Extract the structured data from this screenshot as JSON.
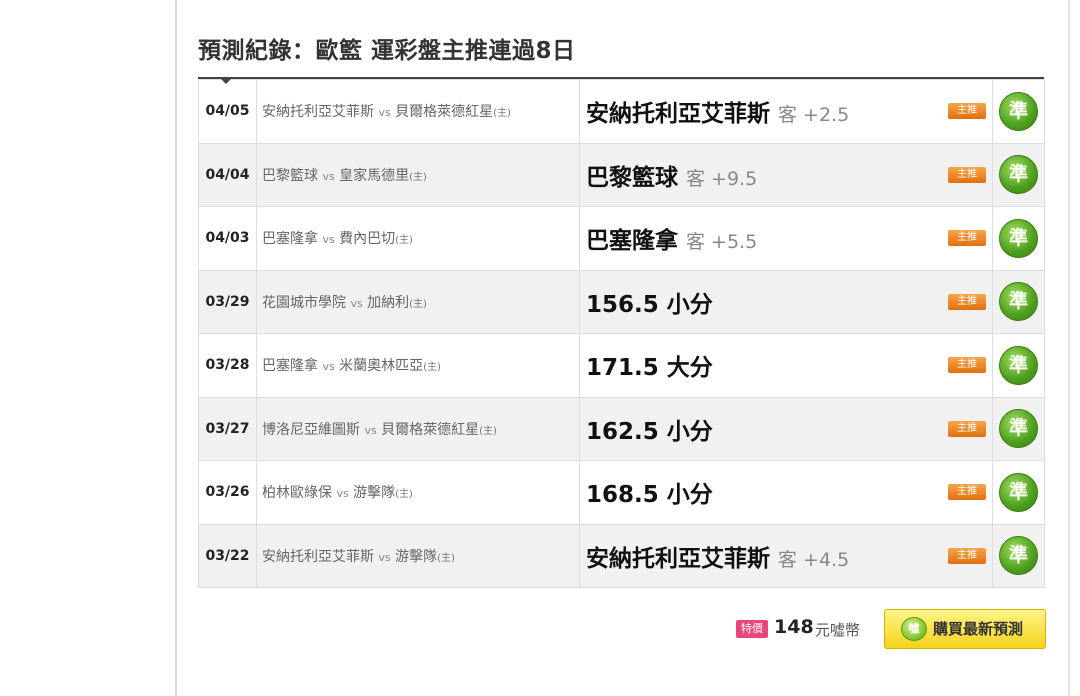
{
  "header": {
    "title_prefix": "預測紀錄：",
    "title_suffix": "歐籃 運彩盤主推連過8日"
  },
  "records": [
    {
      "date": "04/05",
      "team_a": "安納托利亞艾菲斯",
      "vs": "vs",
      "team_b": "貝爾格萊德紅星",
      "home_mark": "(主)",
      "pick": "安納托利亞艾菲斯",
      "pick_extra": "客 +2.5",
      "tag": "主推",
      "result": "準"
    },
    {
      "date": "04/04",
      "team_a": "巴黎籃球",
      "vs": "vs",
      "team_b": "皇家馬德里",
      "home_mark": "(主)",
      "pick": "巴黎籃球",
      "pick_extra": "客 +9.5",
      "tag": "主推",
      "result": "準"
    },
    {
      "date": "04/03",
      "team_a": "巴塞隆拿",
      "vs": "vs",
      "team_b": "費內巴切",
      "home_mark": "(主)",
      "pick": "巴塞隆拿",
      "pick_extra": "客 +5.5",
      "tag": "主推",
      "result": "準"
    },
    {
      "date": "03/29",
      "team_a": "花園城市學院",
      "vs": "vs",
      "team_b": "加納利",
      "home_mark": "(主)",
      "pick": "156.5 小分",
      "pick_extra": "",
      "tag": "主推",
      "result": "準"
    },
    {
      "date": "03/28",
      "team_a": "巴塞隆拿",
      "vs": "vs",
      "team_b": "米蘭奧林匹亞",
      "home_mark": "(主)",
      "pick": "171.5 大分",
      "pick_extra": "",
      "tag": "主推",
      "result": "準"
    },
    {
      "date": "03/27",
      "team_a": "博洛尼亞維圖斯",
      "vs": "vs",
      "team_b": "貝爾格萊德紅星",
      "home_mark": "(主)",
      "pick": "162.5 小分",
      "pick_extra": "",
      "tag": "主推",
      "result": "準"
    },
    {
      "date": "03/26",
      "team_a": "柏林歐綠保",
      "vs": "vs",
      "team_b": "游擊隊",
      "home_mark": "(主)",
      "pick": "168.5 小分",
      "pick_extra": "",
      "tag": "主推",
      "result": "準"
    },
    {
      "date": "03/22",
      "team_a": "安納托利亞艾菲斯",
      "vs": "vs",
      "team_b": "游擊隊",
      "home_mark": "(主)",
      "pick": "安納托利亞艾菲斯",
      "pick_extra": "客 +4.5",
      "tag": "主推",
      "result": "準"
    }
  ],
  "purchase": {
    "special_label": "特價",
    "price": "148",
    "unit": "元噓幣",
    "coin_label": "噓",
    "buy_label": "購買最新預測"
  },
  "colors": {
    "result_badge": "#4d9e1e",
    "tag": "#e07010",
    "special": "#e8467a",
    "buy_button": "#f3d31a"
  }
}
